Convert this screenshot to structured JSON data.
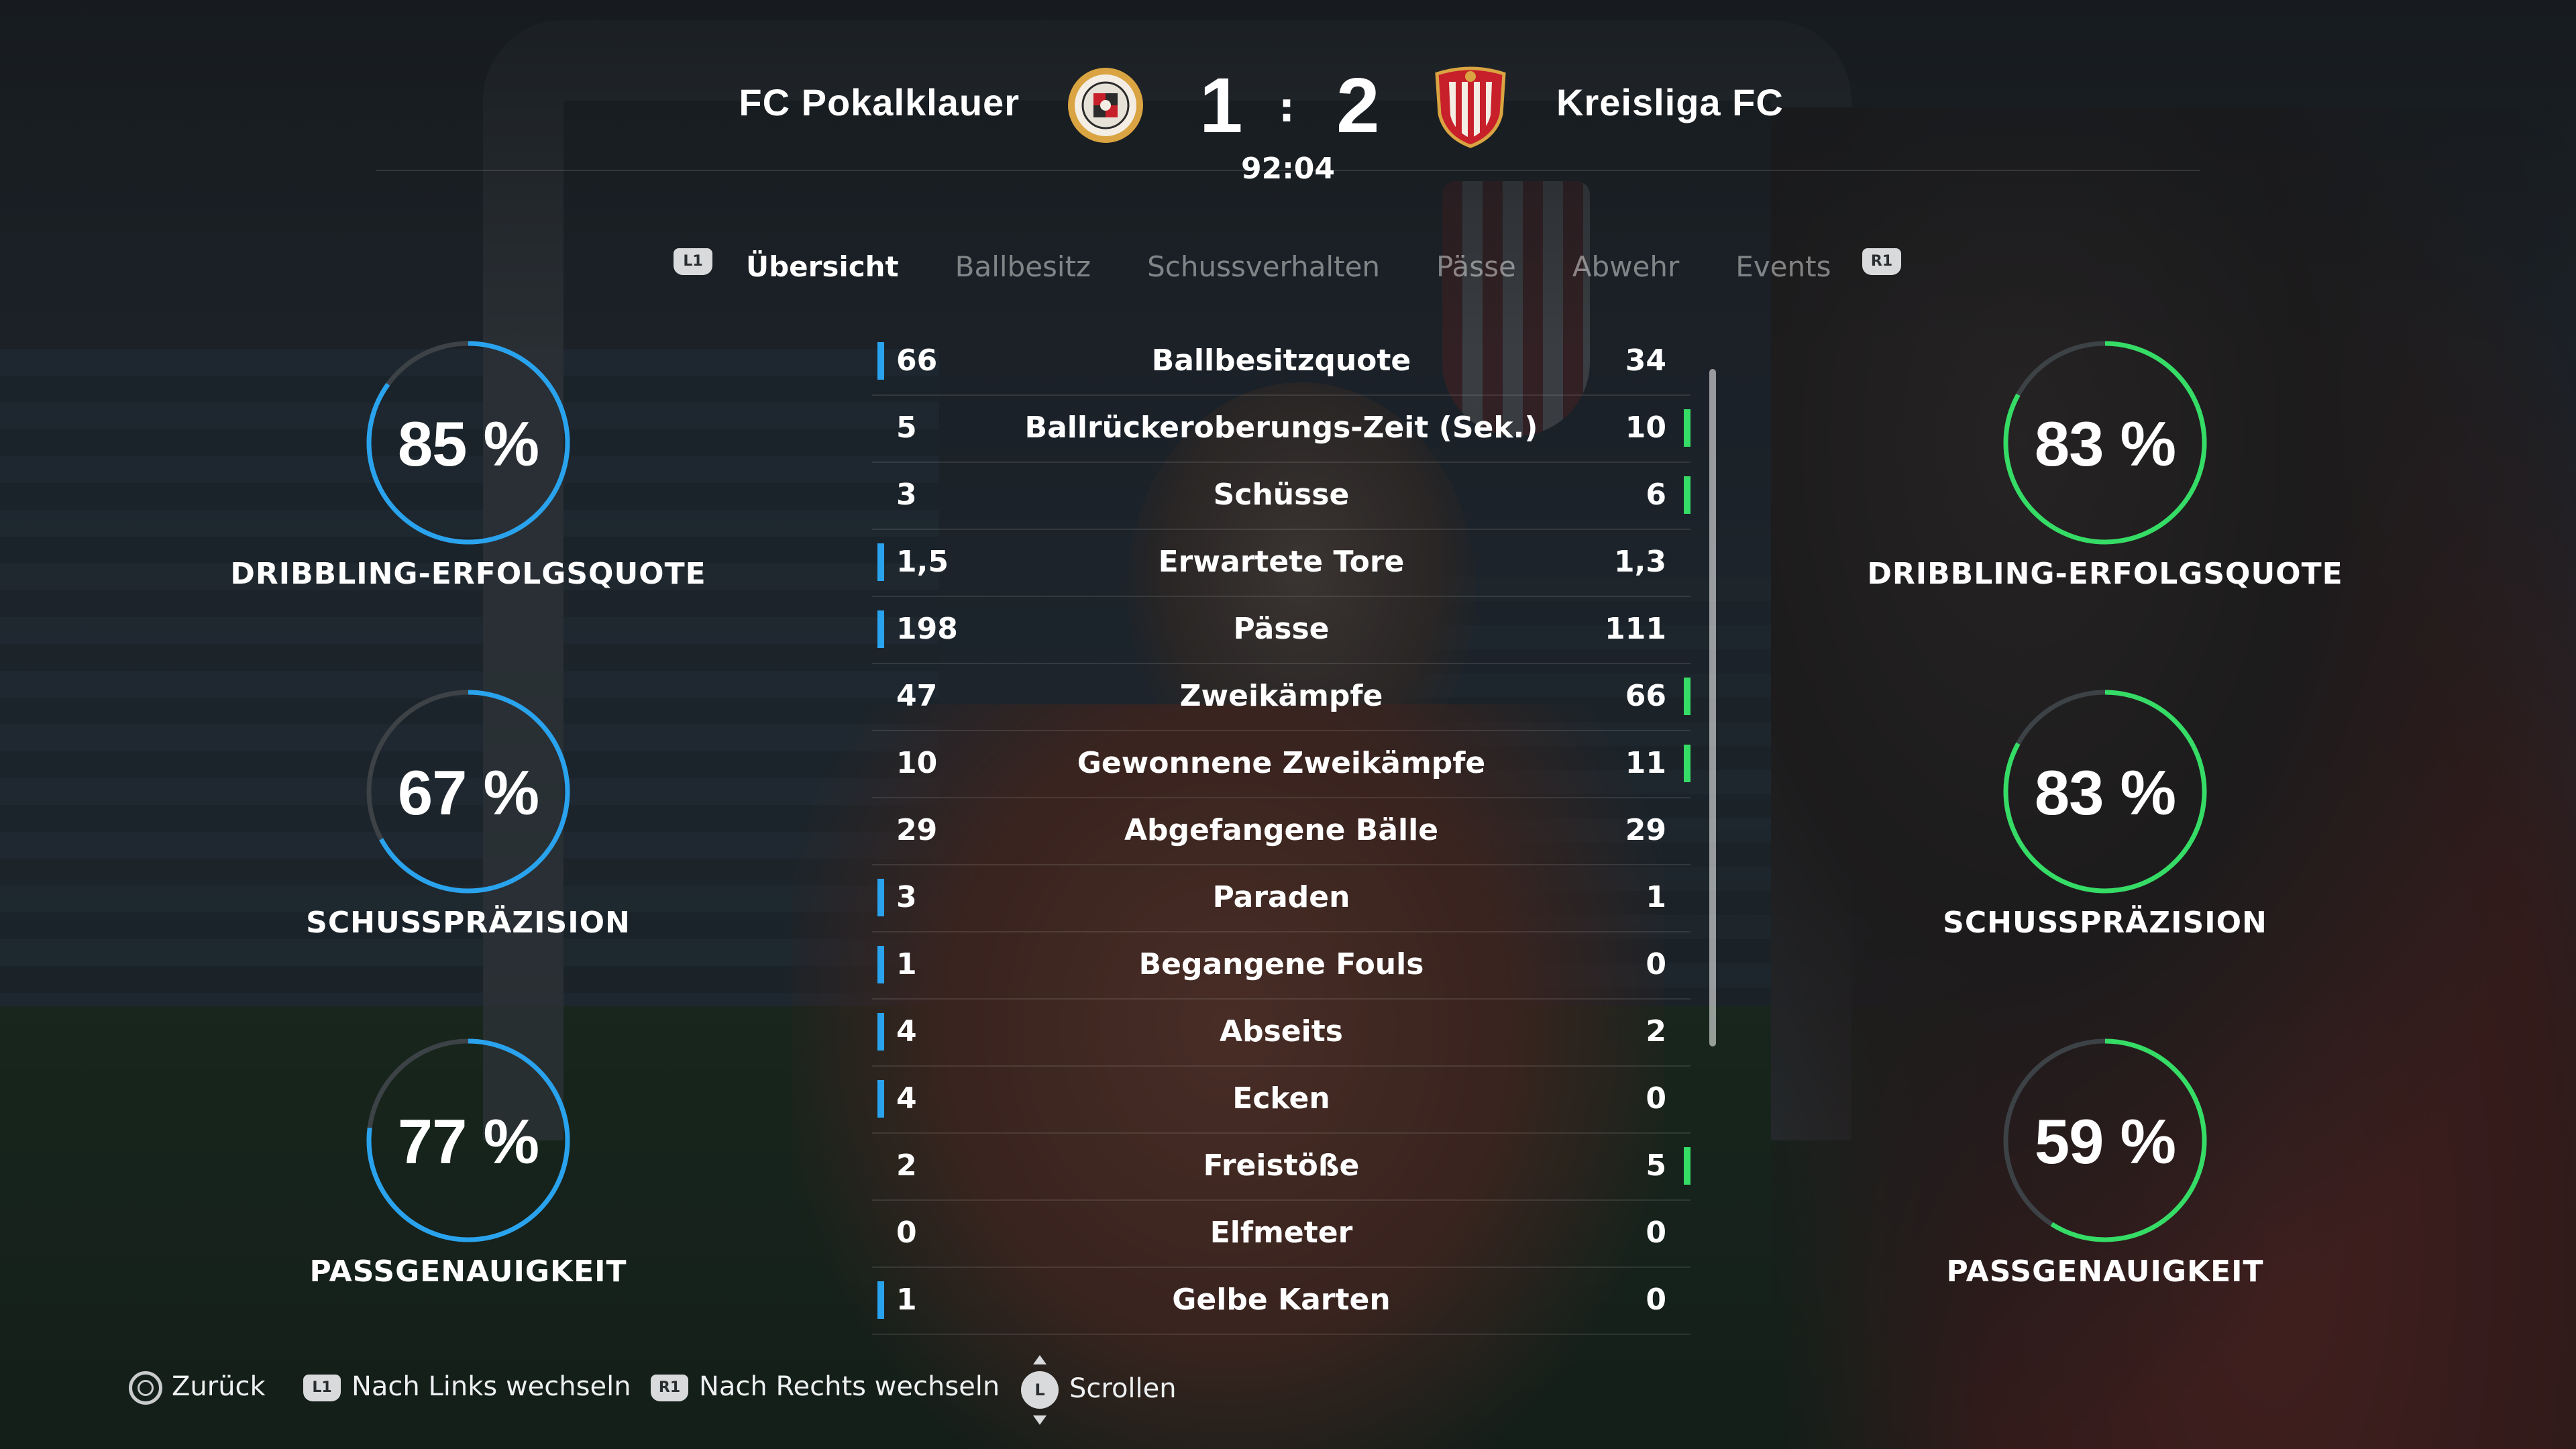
{
  "match": {
    "home_team": "FC Pokalklauer",
    "away_team": "Kreisliga FC",
    "home_score": "1",
    "away_score": "2",
    "separator": ":",
    "clock": "92:04"
  },
  "tabs": {
    "left_key": "L1",
    "right_key": "R1",
    "items": [
      "Übersicht",
      "Ballbesitz",
      "Schussverhalten",
      "Pässe",
      "Abwehr",
      "Events"
    ],
    "active": "Übersicht"
  },
  "stats": [
    {
      "label": "Ballbesitzquote",
      "home": "66",
      "away": "34",
      "leader": "home"
    },
    {
      "label": "Ballrückeroberungs-Zeit (Sek.)",
      "home": "5",
      "away": "10",
      "leader": "away"
    },
    {
      "label": "Schüsse",
      "home": "3",
      "away": "6",
      "leader": "away"
    },
    {
      "label": "Erwartete Tore",
      "home": "1,5",
      "away": "1,3",
      "leader": "home"
    },
    {
      "label": "Pässe",
      "home": "198",
      "away": "111",
      "leader": "home"
    },
    {
      "label": "Zweikämpfe",
      "home": "47",
      "away": "66",
      "leader": "away"
    },
    {
      "label": "Gewonnene Zweikämpfe",
      "home": "10",
      "away": "11",
      "leader": "away"
    },
    {
      "label": "Abgefangene Bälle",
      "home": "29",
      "away": "29",
      "leader": "none"
    },
    {
      "label": "Paraden",
      "home": "3",
      "away": "1",
      "leader": "home"
    },
    {
      "label": "Begangene Fouls",
      "home": "1",
      "away": "0",
      "leader": "home"
    },
    {
      "label": "Abseits",
      "home": "4",
      "away": "2",
      "leader": "home"
    },
    {
      "label": "Ecken",
      "home": "4",
      "away": "0",
      "leader": "home"
    },
    {
      "label": "Freistöße",
      "home": "2",
      "away": "5",
      "leader": "away"
    },
    {
      "label": "Elfmeter",
      "home": "0",
      "away": "0",
      "leader": "none"
    },
    {
      "label": "Gelbe Karten",
      "home": "1",
      "away": "0",
      "leader": "home"
    }
  ],
  "home_rings": [
    {
      "value": 85,
      "text": "85 %",
      "label": "DRIBBLING-ERFOLGSQUOTE"
    },
    {
      "value": 67,
      "text": "67 %",
      "label": "SCHUSSPRÄZISION"
    },
    {
      "value": 77,
      "text": "77 %",
      "label": "PASSGENAUIGKEIT"
    }
  ],
  "away_rings": [
    {
      "value": 83,
      "text": "83 %",
      "label": "DRIBBLING-ERFOLGSQUOTE"
    },
    {
      "value": 83,
      "text": "83 %",
      "label": "SCHUSSPRÄZISION"
    },
    {
      "value": 59,
      "text": "59 %",
      "label": "PASSGENAUIGKEIT"
    }
  ],
  "colors": {
    "home_accent": "#2aa3ee",
    "away_accent": "#35dc65",
    "ring_track": "#3c4246"
  },
  "footer": {
    "back": "Zurück",
    "left_key": "L1",
    "left": "Nach Links wechseln",
    "right_key": "R1",
    "right": "Nach Rechts wechseln",
    "scroll_key": "L",
    "scroll": "Scrollen"
  }
}
